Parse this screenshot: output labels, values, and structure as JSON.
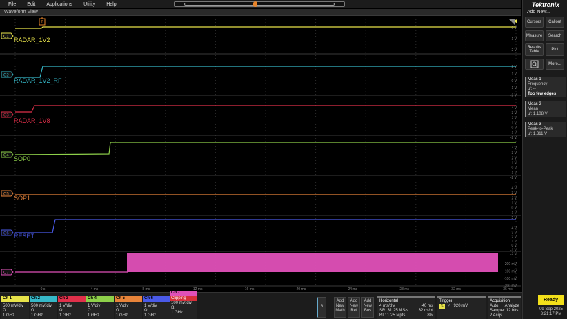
{
  "menu": [
    "File",
    "Edit",
    "Applications",
    "Utility",
    "Help"
  ],
  "waveform_view": {
    "title": "Waveform View"
  },
  "channels": [
    {
      "id": "C1",
      "name": "RADAR_1V2",
      "color": "#e8e34a"
    },
    {
      "id": "C2",
      "name": "RADAR_1V2_RF",
      "color": "#36b8c8"
    },
    {
      "id": "C3",
      "name": "RADAR_1V8",
      "color": "#e0304a"
    },
    {
      "id": "C4",
      "name": "SOP0",
      "color": "#8ed04a"
    },
    {
      "id": "C5",
      "name": "SOP1",
      "color": "#e8843a"
    },
    {
      "id": "C6",
      "name": "RESET",
      "color": "#4a5ae8"
    },
    {
      "id": "C7",
      "name": "",
      "color": "#e050b8"
    }
  ],
  "volt_labels": {
    "c1": [
      "0 V",
      "-1 V",
      "-2 V"
    ],
    "c2": [
      "2 V",
      "1 V",
      "0 V",
      "-1 V",
      "-2 V"
    ],
    "c3": [
      "4 V",
      "3 V",
      "2 V",
      "1 V",
      "0 V",
      "-1 V",
      "-2 V"
    ],
    "c4": [
      "4 V",
      "3 V",
      "2 V",
      "1 V",
      "0 V",
      "-1 V",
      "-2 V"
    ],
    "c5": [
      "4 V",
      "3 V",
      "2 V",
      "1 V",
      "0 V",
      "-1 V",
      "-2 V"
    ],
    "c6": [
      "4 V",
      "3 V",
      "2 V",
      "1 V",
      "0 V",
      "-1 V",
      "-2 V"
    ],
    "c7": [
      "200 mV",
      "100 mV",
      "-100 mV",
      "-200 mV"
    ]
  },
  "time_labels": [
    "0 s",
    "4 ms",
    "8 ms",
    "12 ms",
    "16 ms",
    "20 ms",
    "24 ms",
    "28 ms",
    "32 ms",
    "36 ms"
  ],
  "right_panel": {
    "brand": "Tektronix",
    "add_new": "Add New...",
    "buttons": {
      "cursors": "Cursors",
      "callout": "Callout",
      "measure": "Measure",
      "search": "Search",
      "results_table": "Results Table",
      "plot": "Plot",
      "more": "More..."
    },
    "meas": [
      {
        "title": "Meas 1",
        "name": "Frequency",
        "value": "µ': --",
        "warn": "Too few edges"
      },
      {
        "title": "Meas 2",
        "name": "Mean",
        "value": "µ': 1.108 V",
        "warn": ""
      },
      {
        "title": "Meas 3",
        "name": "Peak-to-Peak",
        "value": "µ': 1.311 V",
        "warn": ""
      }
    ]
  },
  "bottom": {
    "ch": [
      {
        "label": "Ch 1",
        "v1": "500 mV/div",
        "v2": "Ω",
        "v3": "1 GHz",
        "color": "#e8e34a"
      },
      {
        "label": "Ch 2",
        "v1": "500 mV/div",
        "v2": "Ω",
        "v3": "1 GHz",
        "color": "#36b8c8"
      },
      {
        "label": "Ch 3",
        "v1": "1 V/div",
        "v2": "Ω",
        "v3": "1 GHz",
        "color": "#e0304a"
      },
      {
        "label": "Ch 4",
        "v1": "1 V/div",
        "v2": "Ω",
        "v3": "1 GHz",
        "color": "#8ed04a"
      },
      {
        "label": "Ch 5",
        "v1": "1 V/div",
        "v2": "Ω",
        "v3": "1 GHz",
        "color": "#e8843a"
      },
      {
        "label": "Ch 6",
        "v1": "1 V/div",
        "v2": "Ω",
        "v3": "1 GHz",
        "color": "#4a5ae8"
      },
      {
        "label": "Ch 7",
        "v1": "100 mV/div",
        "v2": "Ω",
        "v3": "1 GHz",
        "color": "#e050b8"
      }
    ],
    "clipping": "Clipping",
    "page_num": "8",
    "add_math": "Add New Math",
    "add_ref": "Add New Ref",
    "add_bus": "Add New Bus",
    "horizontal": {
      "title": "Horizontal",
      "l1": "4 ms/div",
      "l2": "SR: 31.25 MS/s",
      "l3": "RL: 1.25 Mpts",
      "r1": "40 ms",
      "r2": "32 ns/pt",
      "r3": "8%"
    },
    "trigger": {
      "title": "Trigger",
      "l1": "920 mV"
    },
    "acquisition": {
      "title": "Acquisition",
      "l1": "Auto,",
      "l2": "Sample: 12 bits",
      "l3": "2 Acqs",
      "r1": "Analyze"
    },
    "ready": "Ready",
    "date": "09 Sep 2025",
    "time": "3:21:17 PM"
  }
}
